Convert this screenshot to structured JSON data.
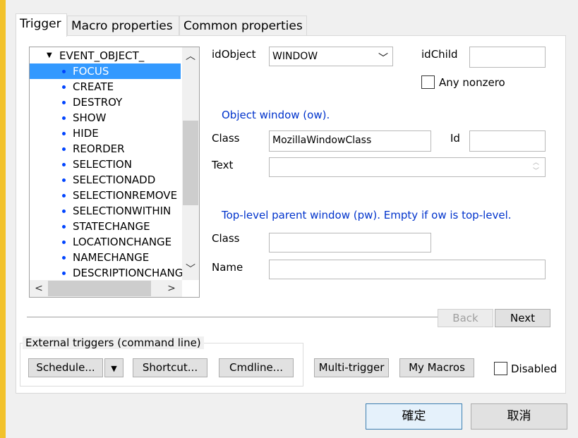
{
  "tabs": [
    {
      "label": "Trigger"
    },
    {
      "label": "Macro properties"
    },
    {
      "label": "Common properties"
    }
  ],
  "tree": {
    "parent": "EVENT_OBJECT_",
    "items": [
      "FOCUS",
      "CREATE",
      "DESTROY",
      "SHOW",
      "HIDE",
      "REORDER",
      "SELECTION",
      "SELECTIONADD",
      "SELECTIONREMOVE",
      "SELECTIONWITHIN",
      "STATECHANGE",
      "LOCATIONCHANGE",
      "NAMECHANGE",
      "DESCRIPTIONCHANG"
    ],
    "selected": "FOCUS"
  },
  "form": {
    "idobject_label": "idObject",
    "idobject_value": "WINDOW",
    "idchild_label": "idChild",
    "idchild_value": "",
    "any_nonzero_label": "Any nonzero",
    "ow_heading": "Object window (ow).",
    "class_label": "Class",
    "class_value": "MozillaWindowClass",
    "id_label": "Id",
    "id_value": "",
    "text_label": "Text",
    "text_value": "",
    "pw_heading": "Top-level parent window (pw). Empty if ow is top-level.",
    "pw_class_label": "Class",
    "pw_class_value": "",
    "pw_name_label": "Name",
    "pw_name_value": ""
  },
  "nav": {
    "back": "Back",
    "next": "Next"
  },
  "external": {
    "title": "External triggers (command line)",
    "schedule": "Schedule...",
    "shortcut": "Shortcut...",
    "cmdline": "Cmdline..."
  },
  "buttons": {
    "multi_trigger": "Multi-trigger",
    "my_macros": "My Macros",
    "disabled_label": "Disabled",
    "ok": "確定",
    "cancel": "取消"
  },
  "icons": {
    "dropdown": "chevron-down-icon",
    "expand": "triangle-down-icon",
    "bullet": "bullet-icon",
    "scroll_up": "chevron-up-icon",
    "scroll_down": "chevron-down-icon",
    "scroll_left": "chevron-left-icon",
    "scroll_right": "chevron-right-icon"
  },
  "colors": {
    "accent_selection": "#3399ff",
    "heading_blue": "#0033cc",
    "frame": "#f2c22b"
  }
}
